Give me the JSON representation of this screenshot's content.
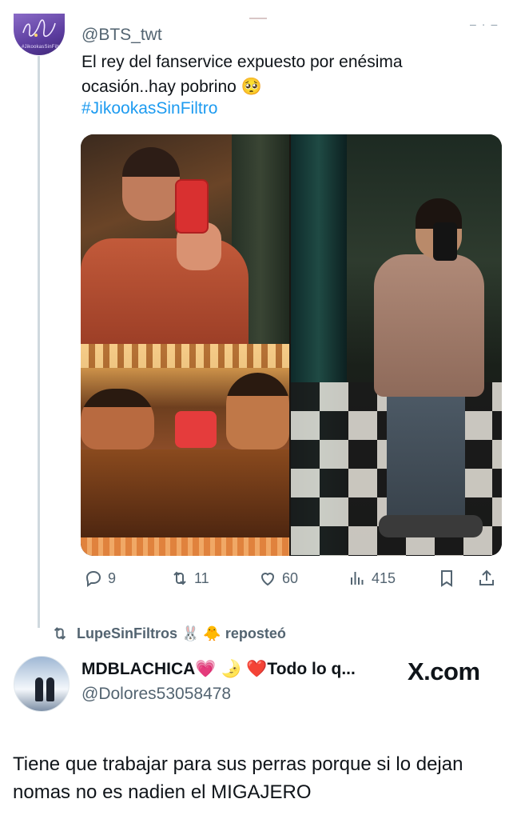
{
  "quoted_tweet": {
    "avatar_text": "Jikookas sin Filtro",
    "avatar_subtext": "#JikookasSinFiltro",
    "handle": "@BTS_twt",
    "text": "El rey del fanservice expuesto por enésima ocasión..hay pobrino 🥺",
    "hashtag": "#JikookasSinFiltro",
    "media_alt": [
      "mirror selfie with red phone",
      "close-up mirror reflection",
      "full-body mirror selfie"
    ],
    "stats": {
      "replies": "9",
      "reposts": "11",
      "likes": "60",
      "views": "415"
    }
  },
  "repost_banner": {
    "text": "LupeSinFiltros 🐰 🐥 reposteó"
  },
  "tweet": {
    "display_name": "MDBLACHICA💗 🌛 ❤️Todo lo q...",
    "handle": "@Dolores53058478",
    "watermark": "X.com",
    "text": "Tiene que trabajar para sus perras porque si lo dejan nomas no es nadien el MIGAJERO"
  },
  "icons": [
    "reply-icon",
    "repost-icon",
    "like-icon",
    "views-icon",
    "bookmark-icon",
    "share-icon"
  ],
  "colors": {
    "link": "#1d9bf0",
    "secondary_text": "#536471",
    "primary_text": "#0f1419"
  }
}
